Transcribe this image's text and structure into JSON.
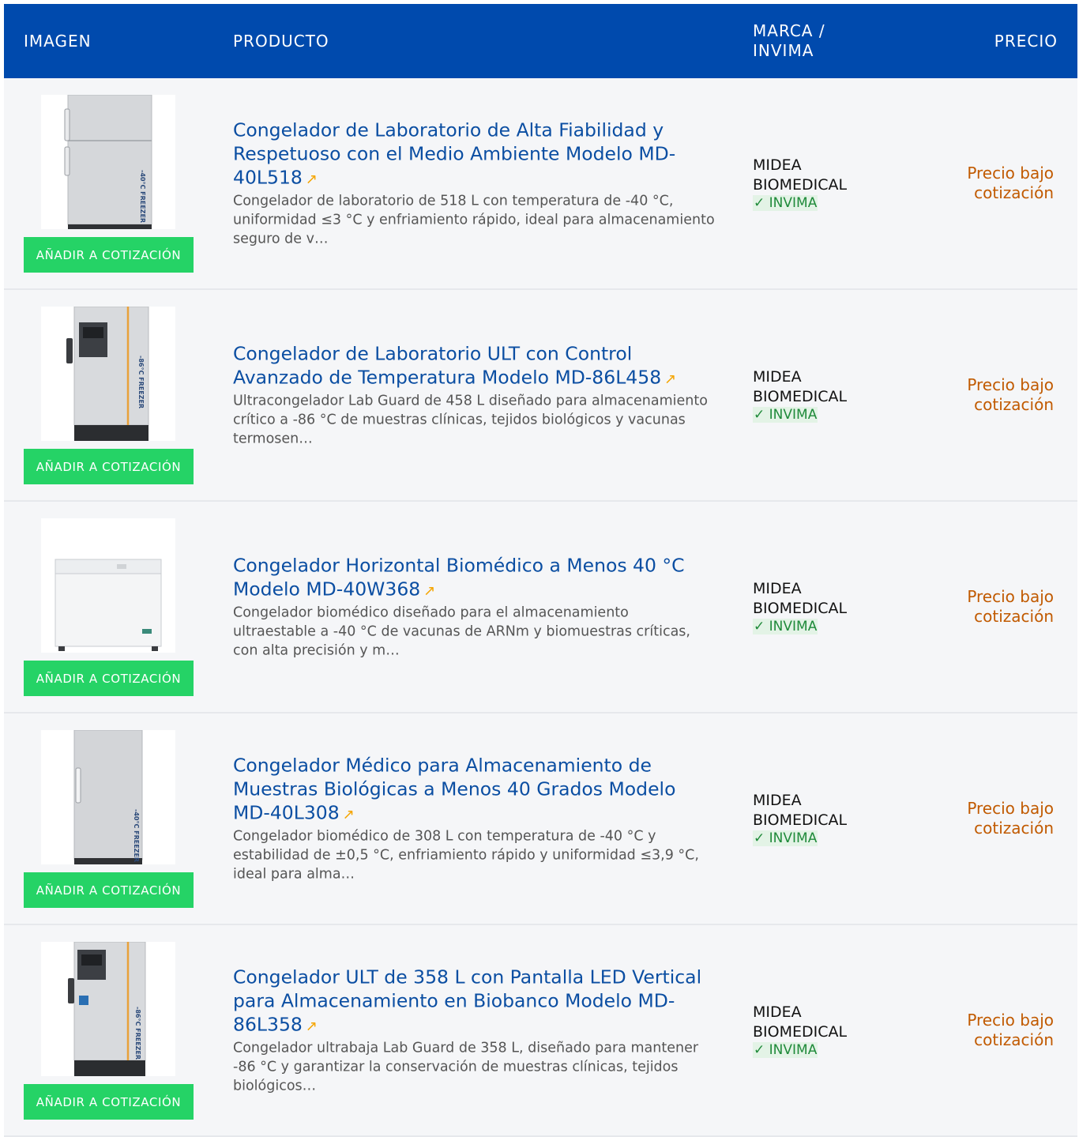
{
  "header": {
    "col_image": "IMAGEN",
    "col_product": "PRODUCTO",
    "col_brand": "MARCA / INVIMA",
    "col_price": "PRECIO"
  },
  "add_button_label": "AÑADIR A COTIZACIÓN",
  "external_link_icon": "↗",
  "rows": [
    {
      "title": "Congelador de Laboratorio de Alta Fiabilidad y Respetuoso con el Medio Ambiente Modelo MD-40L518",
      "description": "Congelador de laboratorio de 518 L con temperatura de -40 °C, uniformidad ≤3 °C y enfriamiento rápido, ideal para almacenamiento seguro de v…",
      "brand": "MIDEA BIOMEDICAL",
      "invima": "✓ INVIMA",
      "price": "Precio bajo cotización",
      "image_icon": "upright-freezer-two-door-image",
      "image_label": "-40°C FREEZER"
    },
    {
      "title": "Congelador de Laboratorio ULT con Control Avanzado de Temperatura Modelo MD-86L458",
      "description": "Ultracongelador Lab Guard de 458 L diseñado para almacenamiento crítico a -86 °C de muestras clínicas, tejidos biológicos y vacunas termosen…",
      "brand": "MIDEA BIOMEDICAL",
      "invima": "✓ INVIMA",
      "price": "Precio bajo cotización",
      "image_icon": "ult-freezer-image",
      "image_label": "-86°C FREEZER"
    },
    {
      "title": "Congelador Horizontal Biomédico a Menos 40 °C Modelo MD-40W368",
      "description": "Congelador biomédico diseñado para el almacenamiento ultraestable a -40 °C de vacunas de ARNm y biomuestras críticas, con alta precisión y m…",
      "brand": "MIDEA BIOMEDICAL",
      "invima": "✓ INVIMA",
      "price": "Precio bajo cotización",
      "image_icon": "chest-freezer-image",
      "image_label": ""
    },
    {
      "title": "Congelador Médico para Almacenamiento de Muestras Biológicas a Menos 40 Grados Modelo MD-40L308",
      "description": "Congelador biomédico de 308 L con temperatura de -40 °C y estabilidad de ±0,5 °C, enfriamiento rápido y uniformidad ≤3,9 °C, ideal para alma…",
      "brand": "MIDEA BIOMEDICAL",
      "invima": "✓ INVIMA",
      "price": "Precio bajo cotización",
      "image_icon": "upright-freezer-single-door-image",
      "image_label": "-40°C FREEZER"
    },
    {
      "title": "Congelador ULT de 358 L con Pantalla LED Vertical para Almacenamiento en Biobanco Modelo MD-86L358",
      "description": "Congelador ultrabaja Lab Guard de 358 L, diseñado para mantener -86 °C y garantizar la conservación de muestras clínicas, tejidos biológicos…",
      "brand": "MIDEA BIOMEDICAL",
      "invima": "✓ INVIMA",
      "price": "Precio bajo cotización",
      "image_icon": "ult-freezer-led-image",
      "image_label": "-86°C FREEZER"
    }
  ]
}
